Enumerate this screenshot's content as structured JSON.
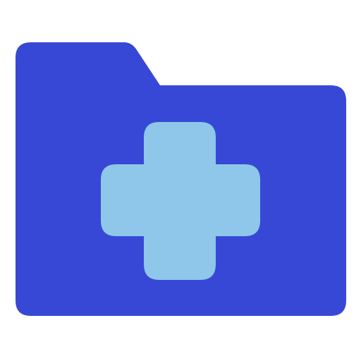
{
  "icon": {
    "name": "medical-folder-icon",
    "components": [
      "folder-icon",
      "medical-cross-icon"
    ]
  },
  "colors": {
    "background": "#ffffff",
    "folder": "#3748d6",
    "cross": "#8ec7ea"
  }
}
